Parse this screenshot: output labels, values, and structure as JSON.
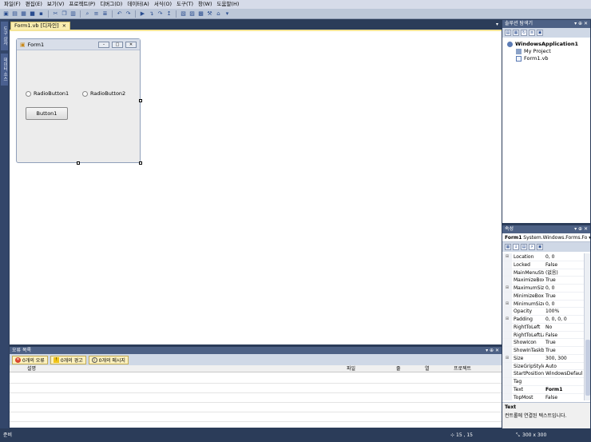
{
  "menu": [
    "파일(F)",
    "편집(E)",
    "보기(V)",
    "프로젝트(P)",
    "디버그(D)",
    "데이터(A)",
    "서식(O)",
    "도구(T)",
    "창(W)",
    "도움말(H)"
  ],
  "left_strip": {
    "toolbox_label": "도구 상자",
    "datasource_label": "데이터 소스"
  },
  "document_tab": {
    "label": "Form1.vb [디자인]",
    "close": "×"
  },
  "form": {
    "title": "Form1",
    "radio1": "RadioButton1",
    "radio2": "RadioButton2",
    "button": "Button1"
  },
  "solution_explorer": {
    "title": "솔루션 탐색기",
    "controls": "▾ ⊕ ✕",
    "items": [
      "WindowsApplication1",
      "My Project",
      "Form1.vb"
    ]
  },
  "properties": {
    "title": "속성",
    "controls": "▾ ⊕ ✕",
    "object_name": "Form1",
    "object_type": "System.Windows.Forms.Fo",
    "rows": [
      {
        "expand": "⊞",
        "name": "Location",
        "value": "0, 0"
      },
      {
        "expand": "",
        "name": "Locked",
        "value": "False"
      },
      {
        "expand": "",
        "name": "MainMenuStr",
        "value": "(없음)"
      },
      {
        "expand": "",
        "name": "MaximizeBox",
        "value": "True"
      },
      {
        "expand": "⊞",
        "name": "MaximumSize",
        "value": "0, 0"
      },
      {
        "expand": "",
        "name": "MinimizeBox",
        "value": "True"
      },
      {
        "expand": "⊞",
        "name": "MinimumSize",
        "value": "0, 0"
      },
      {
        "expand": "",
        "name": "Opacity",
        "value": "100%"
      },
      {
        "expand": "⊞",
        "name": "Padding",
        "value": "0, 0, 0, 0"
      },
      {
        "expand": "",
        "name": "RightToLeft",
        "value": "No"
      },
      {
        "expand": "",
        "name": "RightToLeftLa",
        "value": "False"
      },
      {
        "expand": "",
        "name": "ShowIcon",
        "value": "True"
      },
      {
        "expand": "",
        "name": "ShowInTaskb",
        "value": "True"
      },
      {
        "expand": "⊞",
        "name": "Size",
        "value": "300, 300"
      },
      {
        "expand": "",
        "name": "SizeGripStyle",
        "value": "Auto"
      },
      {
        "expand": "",
        "name": "StartPosition",
        "value": "WindowsDefaul"
      },
      {
        "expand": "",
        "name": "Tag",
        "value": ""
      },
      {
        "expand": "",
        "name": "Text",
        "value": "Form1"
      },
      {
        "expand": "",
        "name": "TopMost",
        "value": "False"
      }
    ],
    "description_title": "Text",
    "description_text": "컨트롤에 연결된 텍스트입니다."
  },
  "error_list": {
    "title": "오류 목록",
    "controls": "▾ ⊕ ✕",
    "errors": "0개의 오류",
    "warnings": "0개의 경고",
    "messages": "0개의 메시지",
    "columns": [
      "설명",
      "파일",
      "줄",
      "열",
      "프로젝트"
    ]
  },
  "status": {
    "ready": "준비",
    "position": "15 , 15",
    "size": "300 x 300"
  },
  "colors": {
    "ide_background": "#2b3c59",
    "tool_header": "#4d6185",
    "active_tab": "#f9edb0"
  }
}
